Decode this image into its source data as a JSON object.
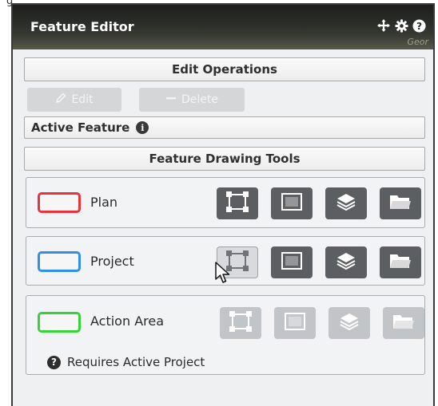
{
  "page_fragment": "g",
  "title_bar": {
    "title": "Feature Editor",
    "icons": [
      "move-icon",
      "gear-icon",
      "help-icon"
    ],
    "overlay_text": "Geor"
  },
  "edit_operations": {
    "heading": "Edit Operations",
    "edit_label": "Edit",
    "delete_label": "Delete"
  },
  "active_feature": {
    "label": "Active Feature",
    "icon": "info-icon"
  },
  "drawing_tools": {
    "heading": "Feature Drawing Tools",
    "layers": [
      {
        "label": "Plan",
        "swatch_color": "#e8323c",
        "enabled": true
      },
      {
        "label": "Project",
        "swatch_color": "#2f8ef0",
        "enabled": true
      },
      {
        "label": "Action Area",
        "swatch_color": "#35d23a",
        "enabled": false,
        "note": "Requires Active Project"
      }
    ],
    "tool_icons": [
      "vertex-edit-icon",
      "rectangle-icon",
      "layers-icon",
      "folder-icon"
    ]
  }
}
